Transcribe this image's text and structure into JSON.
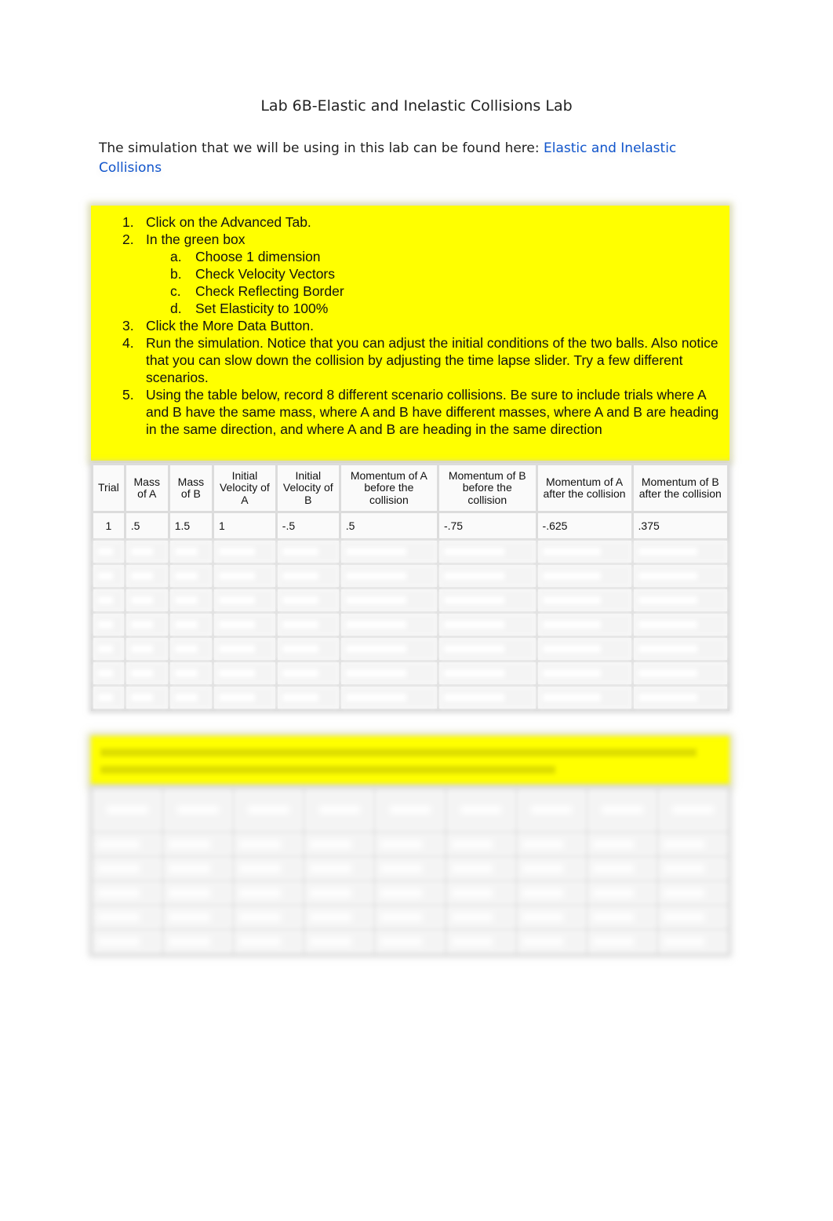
{
  "document": {
    "title": "Lab 6B-Elastic and Inelastic Collisions Lab",
    "intro_text": "The simulation that we will be using in this lab can be found here: ",
    "intro_link": "Elastic and Inelastic Collisions",
    "instructions": [
      {
        "num": "1.",
        "text": "Click on the Advanced Tab."
      },
      {
        "num": "2.",
        "text": "In the green box"
      },
      {
        "num": "a.",
        "text": "Choose 1 dimension",
        "sub": true
      },
      {
        "num": "b.",
        "text": "Check Velocity Vectors",
        "sub": true
      },
      {
        "num": "c.",
        "text": "Check Reflecting Border",
        "sub": true
      },
      {
        "num": "d.",
        "text": "Set Elasticity to 100%",
        "sub": true
      },
      {
        "num": "3.",
        "text": "Click the More Data Button."
      },
      {
        "num": "4.",
        "text": "Run the simulation.  Notice that you can adjust the initial conditions of the two balls.  Also notice that you can slow down the collision by adjusting the time lapse slider.  Try a few different scenarios."
      },
      {
        "num": "5.",
        "text": "Using the table below, record 8 different scenario collisions.  Be sure to include trials where A and B have the same mass, where A and B have different masses, where A and B are heading in the same direction, and where A and B are heading in the same direction"
      }
    ],
    "table": {
      "headers": [
        "Trial",
        "Mass of A",
        "Mass of B",
        "Initial Velocity of A",
        "Initial Velocity of B",
        "Momentum of A before the collision",
        "Momentum of B before the collision",
        "Momentum of A after the collision",
        "Momentum of B after the collision"
      ],
      "rows": [
        [
          "1",
          ".5",
          "1.5",
          "1",
          "-.5",
          ".5",
          "-.75",
          "-.625",
          ".375"
        ]
      ]
    }
  }
}
